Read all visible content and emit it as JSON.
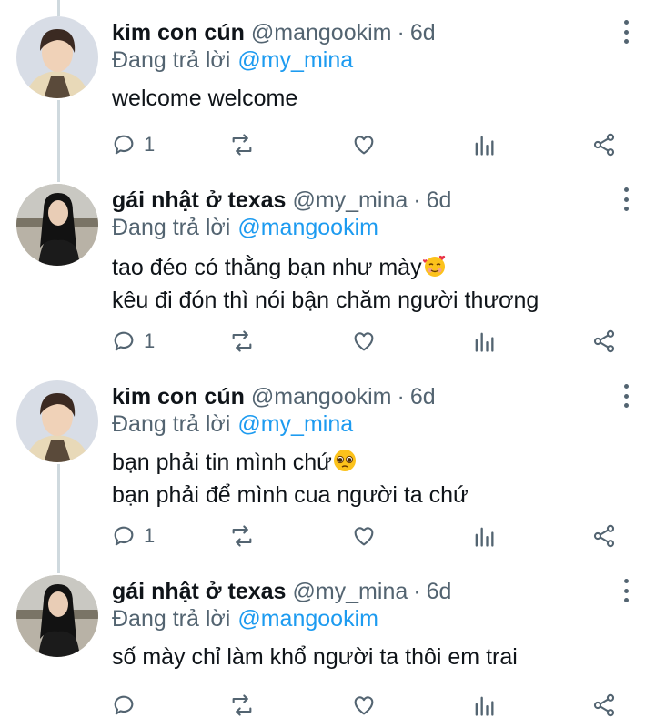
{
  "colors": {
    "text": "#0f1419",
    "secondary": "#536471",
    "link": "#1d9bf0",
    "thread": "#cfd9de"
  },
  "tweets": [
    {
      "name": "kim con cún",
      "handle": "@mangookim",
      "time": "6d",
      "reply_prefix": "Đang trả lời",
      "reply_to": "@my_mina",
      "lines": [
        "welcome welcome"
      ],
      "reply_count": "1",
      "avatar": "boy-avatar"
    },
    {
      "name": "gái nhật ở texas",
      "handle": "@my_mina",
      "time": "6d",
      "reply_prefix": "Đang trả lời",
      "reply_to": "@mangookim",
      "lines": [
        "tao đéo có thằng bạn như mày",
        "kêu đi đón thì nói bận chăm người thương"
      ],
      "line1_emoji": "smiling-face-with-hearts-emoji",
      "reply_count": "1",
      "avatar": "girl-avatar"
    },
    {
      "name": "kim con cún",
      "handle": "@mangookim",
      "time": "6d",
      "reply_prefix": "Đang trả lời",
      "reply_to": "@my_mina",
      "lines": [
        "bạn phải tin mình chứ",
        "bạn phải để mình cua người ta chứ"
      ],
      "line1_emoji": "pleading-face-emoji",
      "reply_count": "1",
      "avatar": "boy-avatar"
    },
    {
      "name": "gái nhật ở texas",
      "handle": "@my_mina",
      "time": "6d",
      "reply_prefix": "Đang trả lời",
      "reply_to": "@mangookim",
      "lines": [
        "số mày chỉ làm khổ người ta thôi em trai"
      ],
      "reply_count": "",
      "avatar": "girl-avatar"
    }
  ],
  "separator": "·"
}
